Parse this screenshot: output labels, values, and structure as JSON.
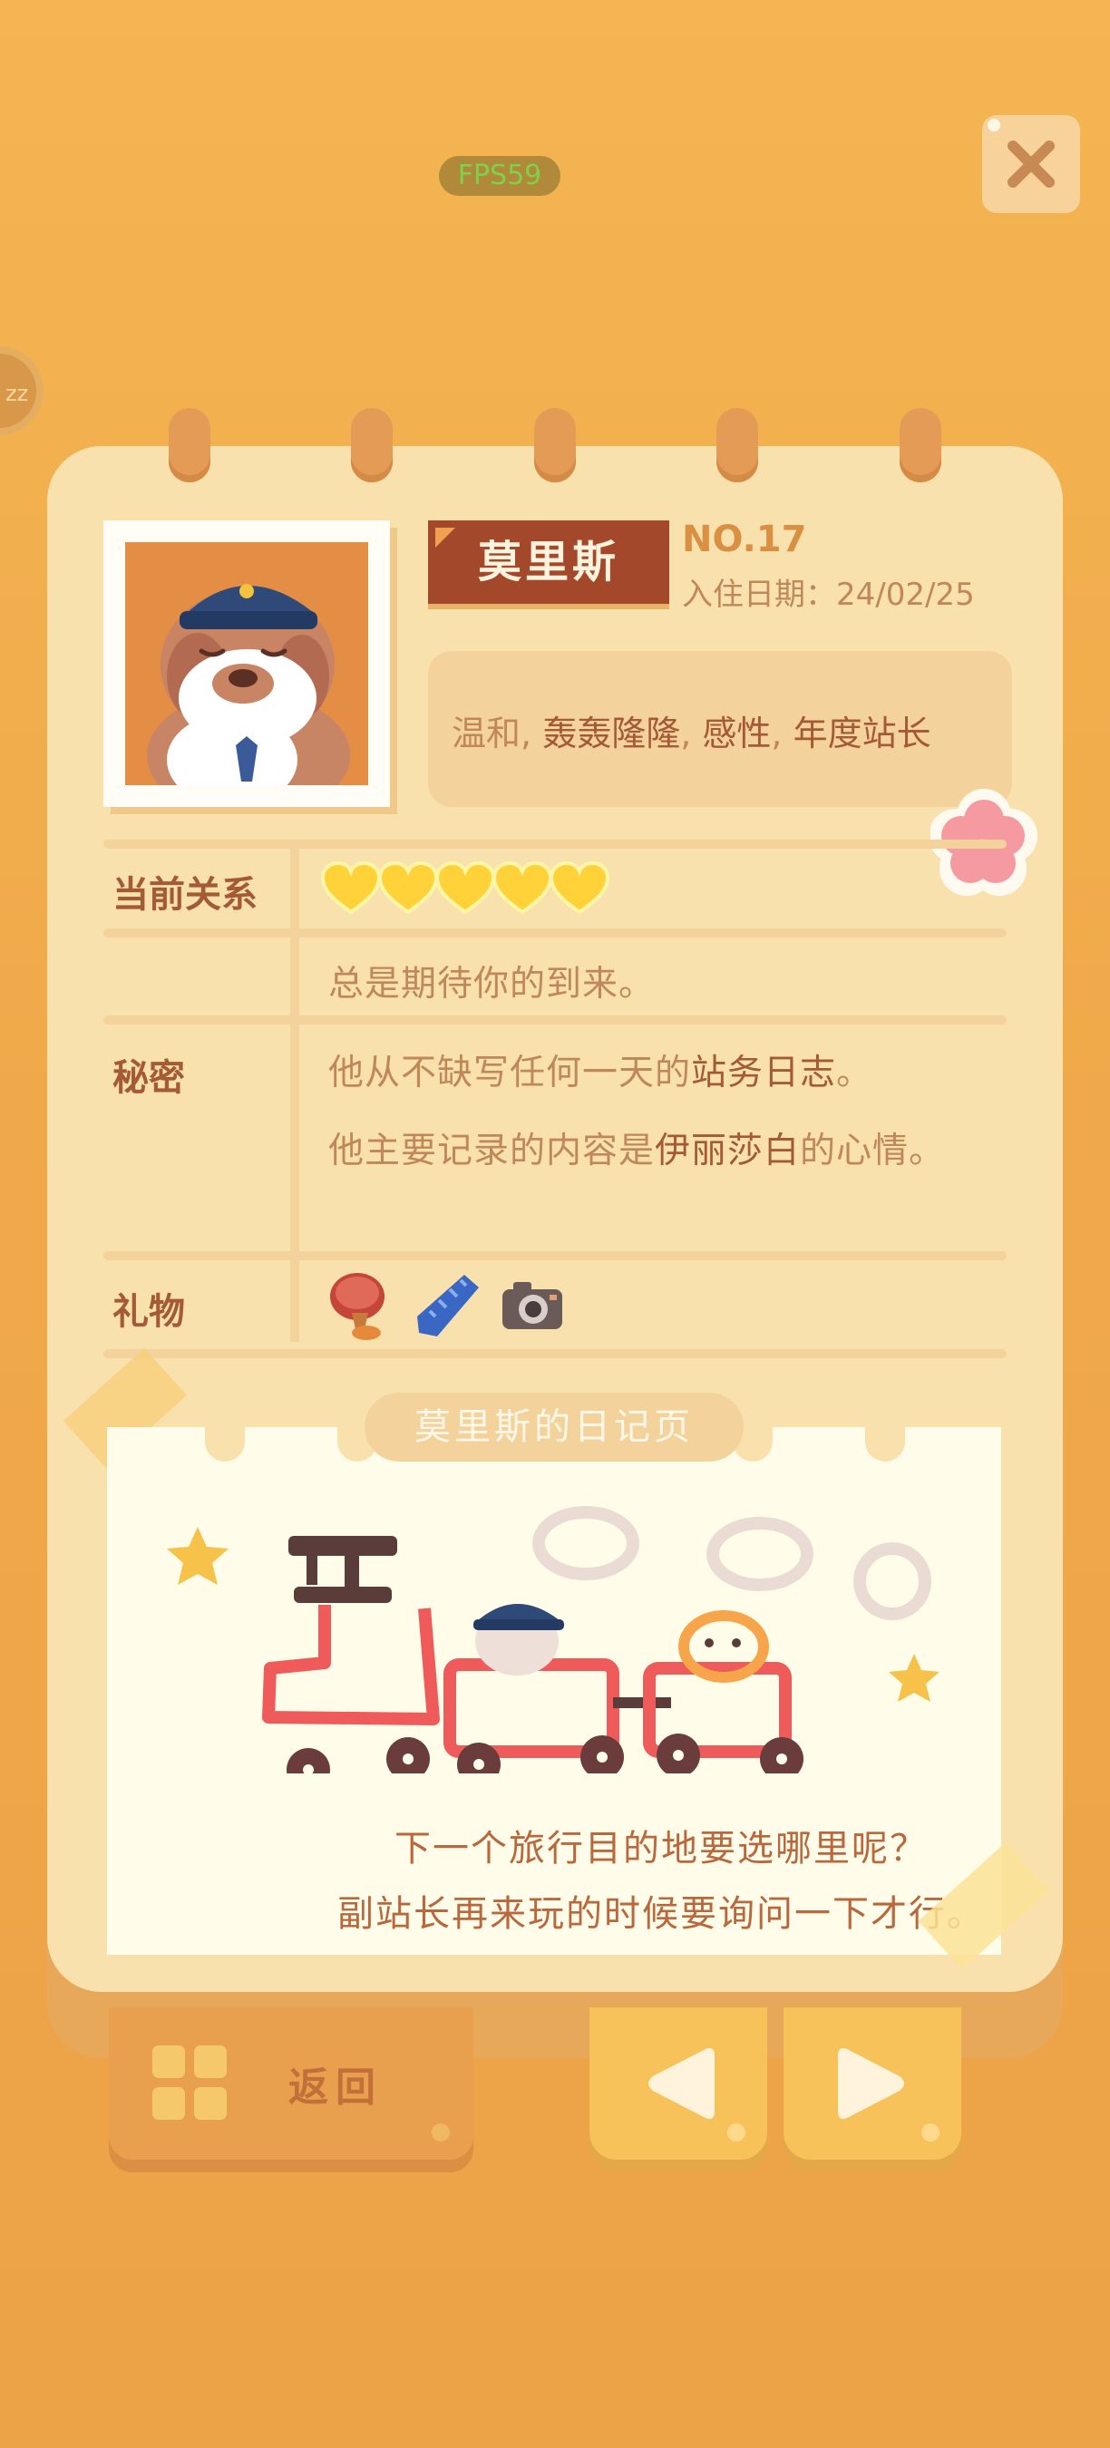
{
  "hud": {
    "fps": "FPS59",
    "side_badge": "zz"
  },
  "character": {
    "name": "莫里斯",
    "number": "NO.17",
    "move_in_date": "入住日期：24/02/25",
    "traits": [
      {
        "text": "温和",
        "highlight": false
      },
      {
        "text": ", ",
        "highlight": false
      },
      {
        "text": "轰轰隆隆",
        "highlight": true
      },
      {
        "text": ", ",
        "highlight": false
      },
      {
        "text": "感性",
        "highlight": true
      },
      {
        "text": ", ",
        "highlight": false
      },
      {
        "text": "年度站长",
        "highlight": true
      }
    ]
  },
  "relationship": {
    "label": "当前关系",
    "hearts_filled": 5,
    "hearts_total": 5,
    "status_text": "总是期待你的到来。"
  },
  "secret": {
    "label": "秘密",
    "line1": {
      "pre": "他从不缺写任何一天的",
      "highlight": "站务日志",
      "post": "。"
    },
    "line2": {
      "pre": "他主要记录的内容是",
      "highlight": "伊丽莎白",
      "post": "的心情。"
    }
  },
  "gifts": {
    "label": "礼物",
    "items": [
      "stamp-icon",
      "necktie-icon",
      "camera-icon"
    ]
  },
  "diary": {
    "title": "莫里斯的日记页",
    "line1": "下一个旅行目的地要选哪里呢？",
    "line2": "副站长再来玩的时候要询问一下才行。"
  },
  "buttons": {
    "back": "返回"
  },
  "colors": {
    "background": "#f4b552",
    "paper": "#f9e1ad",
    "name_tag": "#a4482c",
    "heart": "#ffd23a",
    "accent_text": "#a45a34"
  }
}
